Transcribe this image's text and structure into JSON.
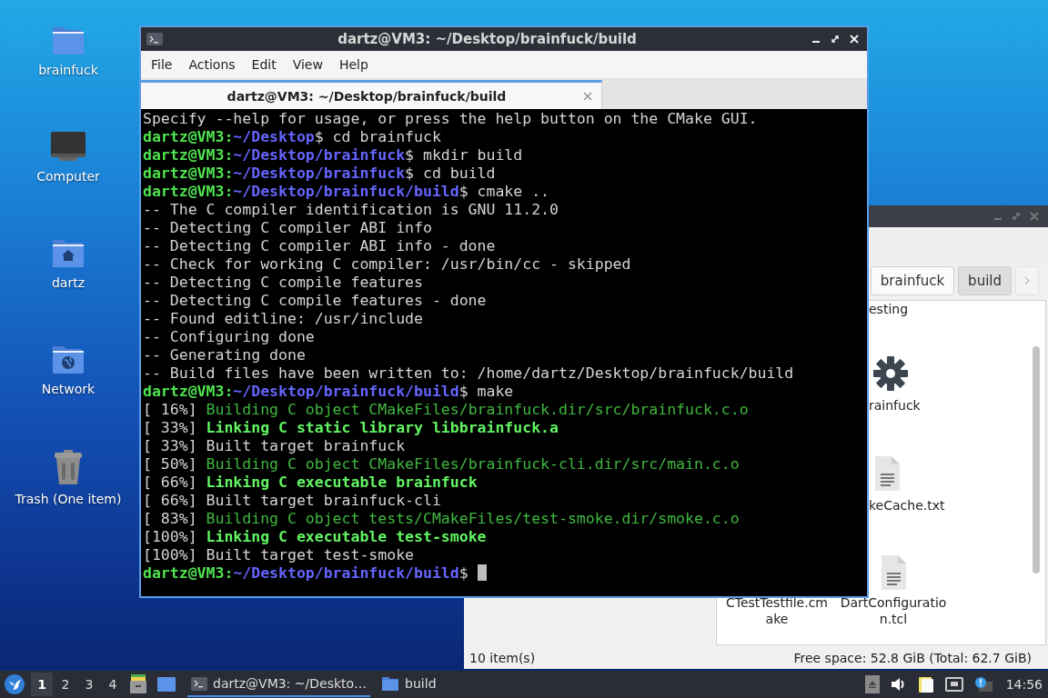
{
  "desktop_icons": [
    {
      "label": "brainfuck",
      "kind": "folder"
    },
    {
      "label": "Computer",
      "kind": "computer"
    },
    {
      "label": "dartz",
      "kind": "home"
    },
    {
      "label": "Network",
      "kind": "network"
    },
    {
      "label": "Trash (One item)",
      "kind": "trash"
    }
  ],
  "file_manager": {
    "path_buttons": [
      {
        "label": "brainfuck",
        "selected": false
      },
      {
        "label": "build",
        "selected": true
      }
    ],
    "partial_items": [
      {
        "label": "esting",
        "kind": "none"
      },
      {
        "label": "rainfuck",
        "kind": "gear"
      },
      {
        "label": "keCache.txt",
        "kind": "document"
      }
    ],
    "items": [
      {
        "label": "CTestTestfile.cm ake",
        "kind": "none"
      },
      {
        "label": "DartConfiguratio n.tcl",
        "kind": "document"
      }
    ],
    "status_left": "10 item(s)",
    "status_right": "Free space: 52.8 GiB (Total: 62.7 GiB)"
  },
  "terminal": {
    "title": "dartz@VM3: ~/Desktop/brainfuck/build",
    "menu": [
      "File",
      "Actions",
      "Edit",
      "View",
      "Help"
    ],
    "tabs": [
      {
        "label": "dartz@VM3: ~/Desktop/brainfuck/build",
        "selected": true
      }
    ],
    "lines": [
      {
        "kind": "output",
        "text": "Specify --help for usage, or press the help button on the CMake GUI."
      },
      {
        "kind": "prompt",
        "user": "dartz@VM3:",
        "path": "~/Desktop",
        "command": "$ cd brainfuck"
      },
      {
        "kind": "prompt",
        "user": "dartz@VM3:",
        "path": "~/Desktop/brainfuck",
        "command": "$ mkdir build"
      },
      {
        "kind": "prompt",
        "user": "dartz@VM3:",
        "path": "~/Desktop/brainfuck",
        "command": "$ cd build"
      },
      {
        "kind": "prompt",
        "user": "dartz@VM3:",
        "path": "~/Desktop/brainfuck/build",
        "command": "$ cmake .."
      },
      {
        "kind": "output",
        "text": "-- The C compiler identification is GNU 11.2.0"
      },
      {
        "kind": "output",
        "text": "-- Detecting C compiler ABI info"
      },
      {
        "kind": "output",
        "text": "-- Detecting C compiler ABI info - done"
      },
      {
        "kind": "output",
        "text": "-- Check for working C compiler: /usr/bin/cc - skipped"
      },
      {
        "kind": "output",
        "text": "-- Detecting C compile features"
      },
      {
        "kind": "output",
        "text": "-- Detecting C compile features - done"
      },
      {
        "kind": "output",
        "text": "-- Found editline: /usr/include"
      },
      {
        "kind": "output",
        "text": "-- Configuring done"
      },
      {
        "kind": "output",
        "text": "-- Generating done"
      },
      {
        "kind": "output",
        "text": "-- Build files have been written to: /home/dartz/Desktop/brainfuck/build"
      },
      {
        "kind": "prompt",
        "user": "dartz@VM3:",
        "path": "~/Desktop/brainfuck/build",
        "command": "$ make"
      },
      {
        "kind": "build",
        "percent": "[ 16%]",
        "text": "Building C object CMakeFiles/brainfuck.dir/src/brainfuck.c.o"
      },
      {
        "kind": "link",
        "percent": "[ 33%]",
        "text": "Linking C static library libbrainfuck.a"
      },
      {
        "kind": "target",
        "percent": "[ 33%]",
        "text": "Built target brainfuck"
      },
      {
        "kind": "build",
        "percent": "[ 50%]",
        "text": "Building C object CMakeFiles/brainfuck-cli.dir/src/main.c.o"
      },
      {
        "kind": "link",
        "percent": "[ 66%]",
        "text": "Linking C executable brainfuck"
      },
      {
        "kind": "target",
        "percent": "[ 66%]",
        "text": "Built target brainfuck-cli"
      },
      {
        "kind": "build",
        "percent": "[ 83%]",
        "text": "Building C object tests/CMakeFiles/test-smoke.dir/smoke.c.o"
      },
      {
        "kind": "link",
        "percent": "[100%]",
        "text": "Linking C executable test-smoke"
      },
      {
        "kind": "target",
        "percent": "[100%]",
        "text": "Built target test-smoke"
      },
      {
        "kind": "prompt",
        "user": "dartz@VM3:",
        "path": "~/Desktop/brainfuck/build",
        "command": "$ "
      }
    ],
    "cursor": true
  },
  "taskbar": {
    "workspaces": [
      {
        "label": "1",
        "selected": true
      },
      {
        "label": "2",
        "selected": false
      },
      {
        "label": "3",
        "selected": false
      },
      {
        "label": "4",
        "selected": false
      }
    ],
    "tasks": [
      {
        "label": "dartz@VM3: ~/Deskto…",
        "kind": "terminal",
        "selected": true
      },
      {
        "label": "build",
        "kind": "folder",
        "selected": false
      }
    ],
    "clock": "14:56"
  }
}
